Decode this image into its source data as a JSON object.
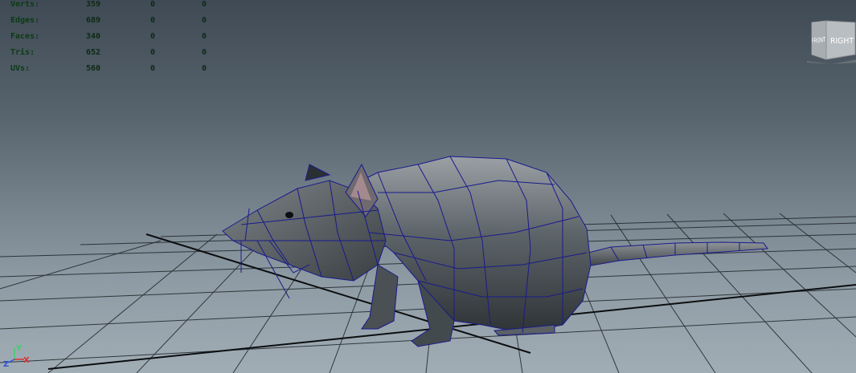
{
  "viewport": {
    "view_cube": {
      "front_label": "FRONT",
      "right_label": "RIGHT"
    },
    "axis_indicator": {
      "x_label": "X",
      "y_label": "Y",
      "z_label": "Z"
    }
  },
  "hud": {
    "rows": [
      {
        "label": "Verts:",
        "v1": "359",
        "v2": "0",
        "v3": "0"
      },
      {
        "label": "Edges:",
        "v1": "689",
        "v2": "0",
        "v3": "0"
      },
      {
        "label": "Faces:",
        "v1": "340",
        "v2": "0",
        "v3": "0"
      },
      {
        "label": "Tris:",
        "v1": "652",
        "v2": "0",
        "v3": "0"
      },
      {
        "label": "UVs:",
        "v1": "560",
        "v2": "0",
        "v3": "0"
      }
    ]
  },
  "colors": {
    "hud_text": "#0b3a14",
    "grid_line": "#1e2428",
    "wireframe": "#1a1a8c",
    "mesh_dark": "#3c4246",
    "mesh_light": "#8a9096"
  },
  "icons": [
    "view-cube-icon",
    "axis-indicator-icon"
  ]
}
